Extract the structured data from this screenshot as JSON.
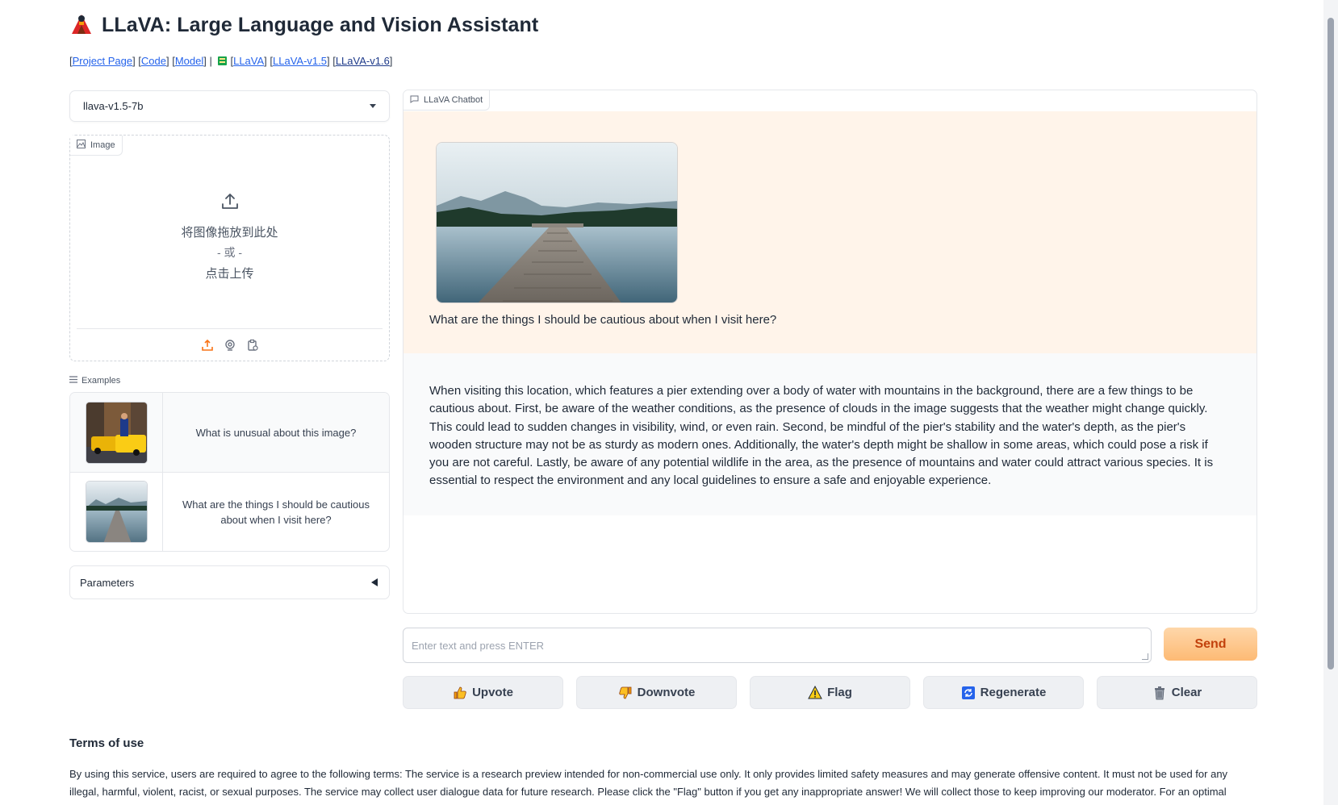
{
  "header": {
    "title": "LLaVA: Large Language and Vision Assistant",
    "logo_icon": "volcano-logo-icon"
  },
  "links": {
    "project_page": "Project Page",
    "code": "Code",
    "model": "Model",
    "llava": "LLaVA",
    "llava_v15": "LLaVA-v1.5",
    "llava_v16": "LLaVA-v1.6"
  },
  "model_select": {
    "value": "llava-v1.5-7b"
  },
  "image_input": {
    "label": "Image",
    "drop_text": "将图像拖放到此处",
    "or_text": "- 或 -",
    "click_text": "点击上传"
  },
  "examples": {
    "label": "Examples",
    "items": [
      {
        "text": "What is unusual about this image?"
      },
      {
        "text": "What are the things I should be cautious about when I visit here?"
      }
    ]
  },
  "parameters": {
    "label": "Parameters"
  },
  "chatbot": {
    "label": "LLaVA Chatbot",
    "user_message": "What are the things I should be cautious about when I visit here?",
    "bot_message": "When visiting this location, which features a pier extending over a body of water with mountains in the background, there are a few things to be cautious about. First, be aware of the weather conditions, as the presence of clouds in the image suggests that the weather might change quickly. This could lead to sudden changes in visibility, wind, or even rain. Second, be mindful of the pier's stability and the water's depth, as the pier's wooden structure may not be as sturdy as modern ones. Additionally, the water's depth might be shallow in some areas, which could pose a risk if you are not careful. Lastly, be aware of any potential wildlife in the area, as the presence of mountains and water could attract various species. It is essential to respect the environment and any local guidelines to ensure a safe and enjoyable experience."
  },
  "input": {
    "placeholder": "Enter text and press ENTER"
  },
  "buttons": {
    "send": "Send",
    "upvote": "Upvote",
    "downvote": "Downvote",
    "flag": "Flag",
    "regenerate": "Regenerate",
    "clear": "Clear"
  },
  "terms": {
    "heading": "Terms of use",
    "body": "By using this service, users are required to agree to the following terms: The service is a research preview intended for non-commercial use only. It only provides limited safety measures and may generate offensive content. It must not be used for any illegal, harmful, violent, racist, or sexual purposes. The service may collect user dialogue data for future research. Please click the \"Flag\" button if you get any inappropriate answer! We will collect those to keep improving our moderator. For an optimal"
  },
  "colors": {
    "accent": "#f97316",
    "send_bg": "#fdba74",
    "user_msg_bg": "#fff4ea",
    "bot_msg_bg": "#f9fafb",
    "link": "#2563eb"
  }
}
